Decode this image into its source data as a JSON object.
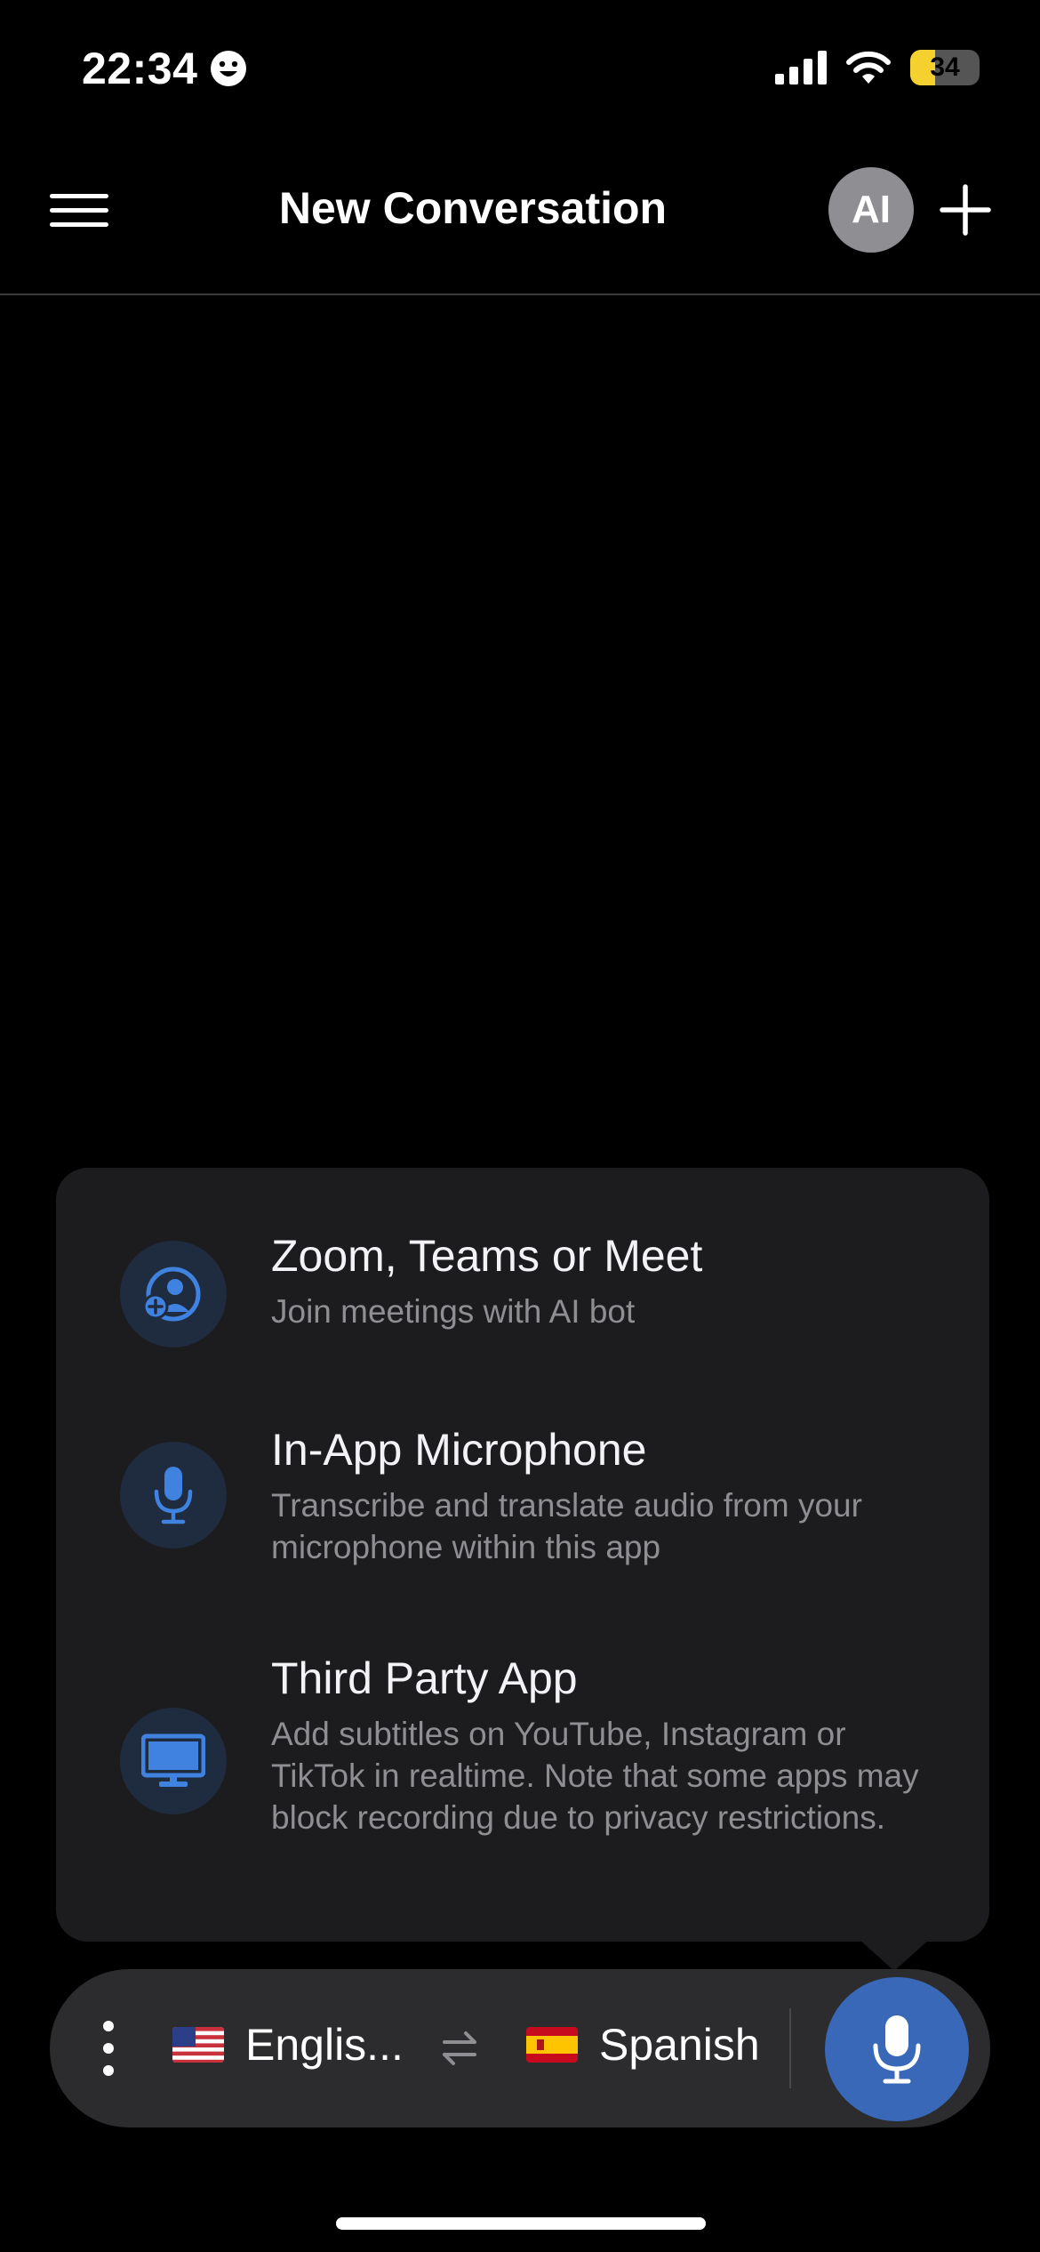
{
  "status_bar": {
    "time": "22:34",
    "focus_icon": "smiley-face-icon",
    "battery_level": "34",
    "battery_color": "#f5d130"
  },
  "header": {
    "title": "New Conversation",
    "avatar_initials": "AI"
  },
  "popup": {
    "options": [
      {
        "title": "Zoom, Teams or Meet",
        "description": "Join meetings with AI bot",
        "icon": "add-user-icon"
      },
      {
        "title": "In-App Microphone",
        "description": "Transcribe and translate audio from your microphone within this app",
        "icon": "microphone-icon"
      },
      {
        "title": "Third Party App",
        "description": "Add subtitles on YouTube, Instagram or TikTok in realtime. Note that some apps may block recording due to privacy restrictions.",
        "icon": "monitor-icon"
      }
    ]
  },
  "bottom_bar": {
    "source_language": "Englis...",
    "target_language": "Spanish",
    "accent_color": "#3a68b8"
  }
}
